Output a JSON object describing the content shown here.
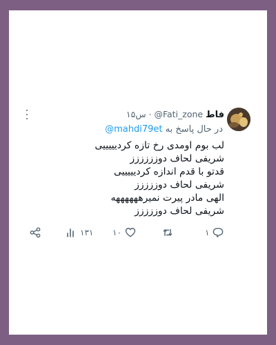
{
  "tweet": {
    "display_name": "فاط",
    "handle": "@Fati_zone",
    "separator": "·",
    "time": "۱۵س",
    "replying_prefix": "در حال پاسخ به",
    "replying_to": "@mahdi79et",
    "lines": [
      "لب بوم اومدی رخ تازه کردیییییی",
      "شریفی لحاف دوزززززز",
      "قدتو با قدم اندازه کردیییییی",
      "شریفی لحاف دوززززز",
      "الهی مادر پیرت نمیرههههههه",
      "شریفی لحاف دوززززز"
    ],
    "stats": {
      "replies": "۱",
      "retweets": "",
      "likes": "۱۰",
      "views": "۱۳۱"
    }
  },
  "colors": {
    "background": "#7d5f84",
    "card": "#ffffff",
    "text": "#0f1419",
    "muted": "#536471",
    "link": "#1d9bf0"
  }
}
